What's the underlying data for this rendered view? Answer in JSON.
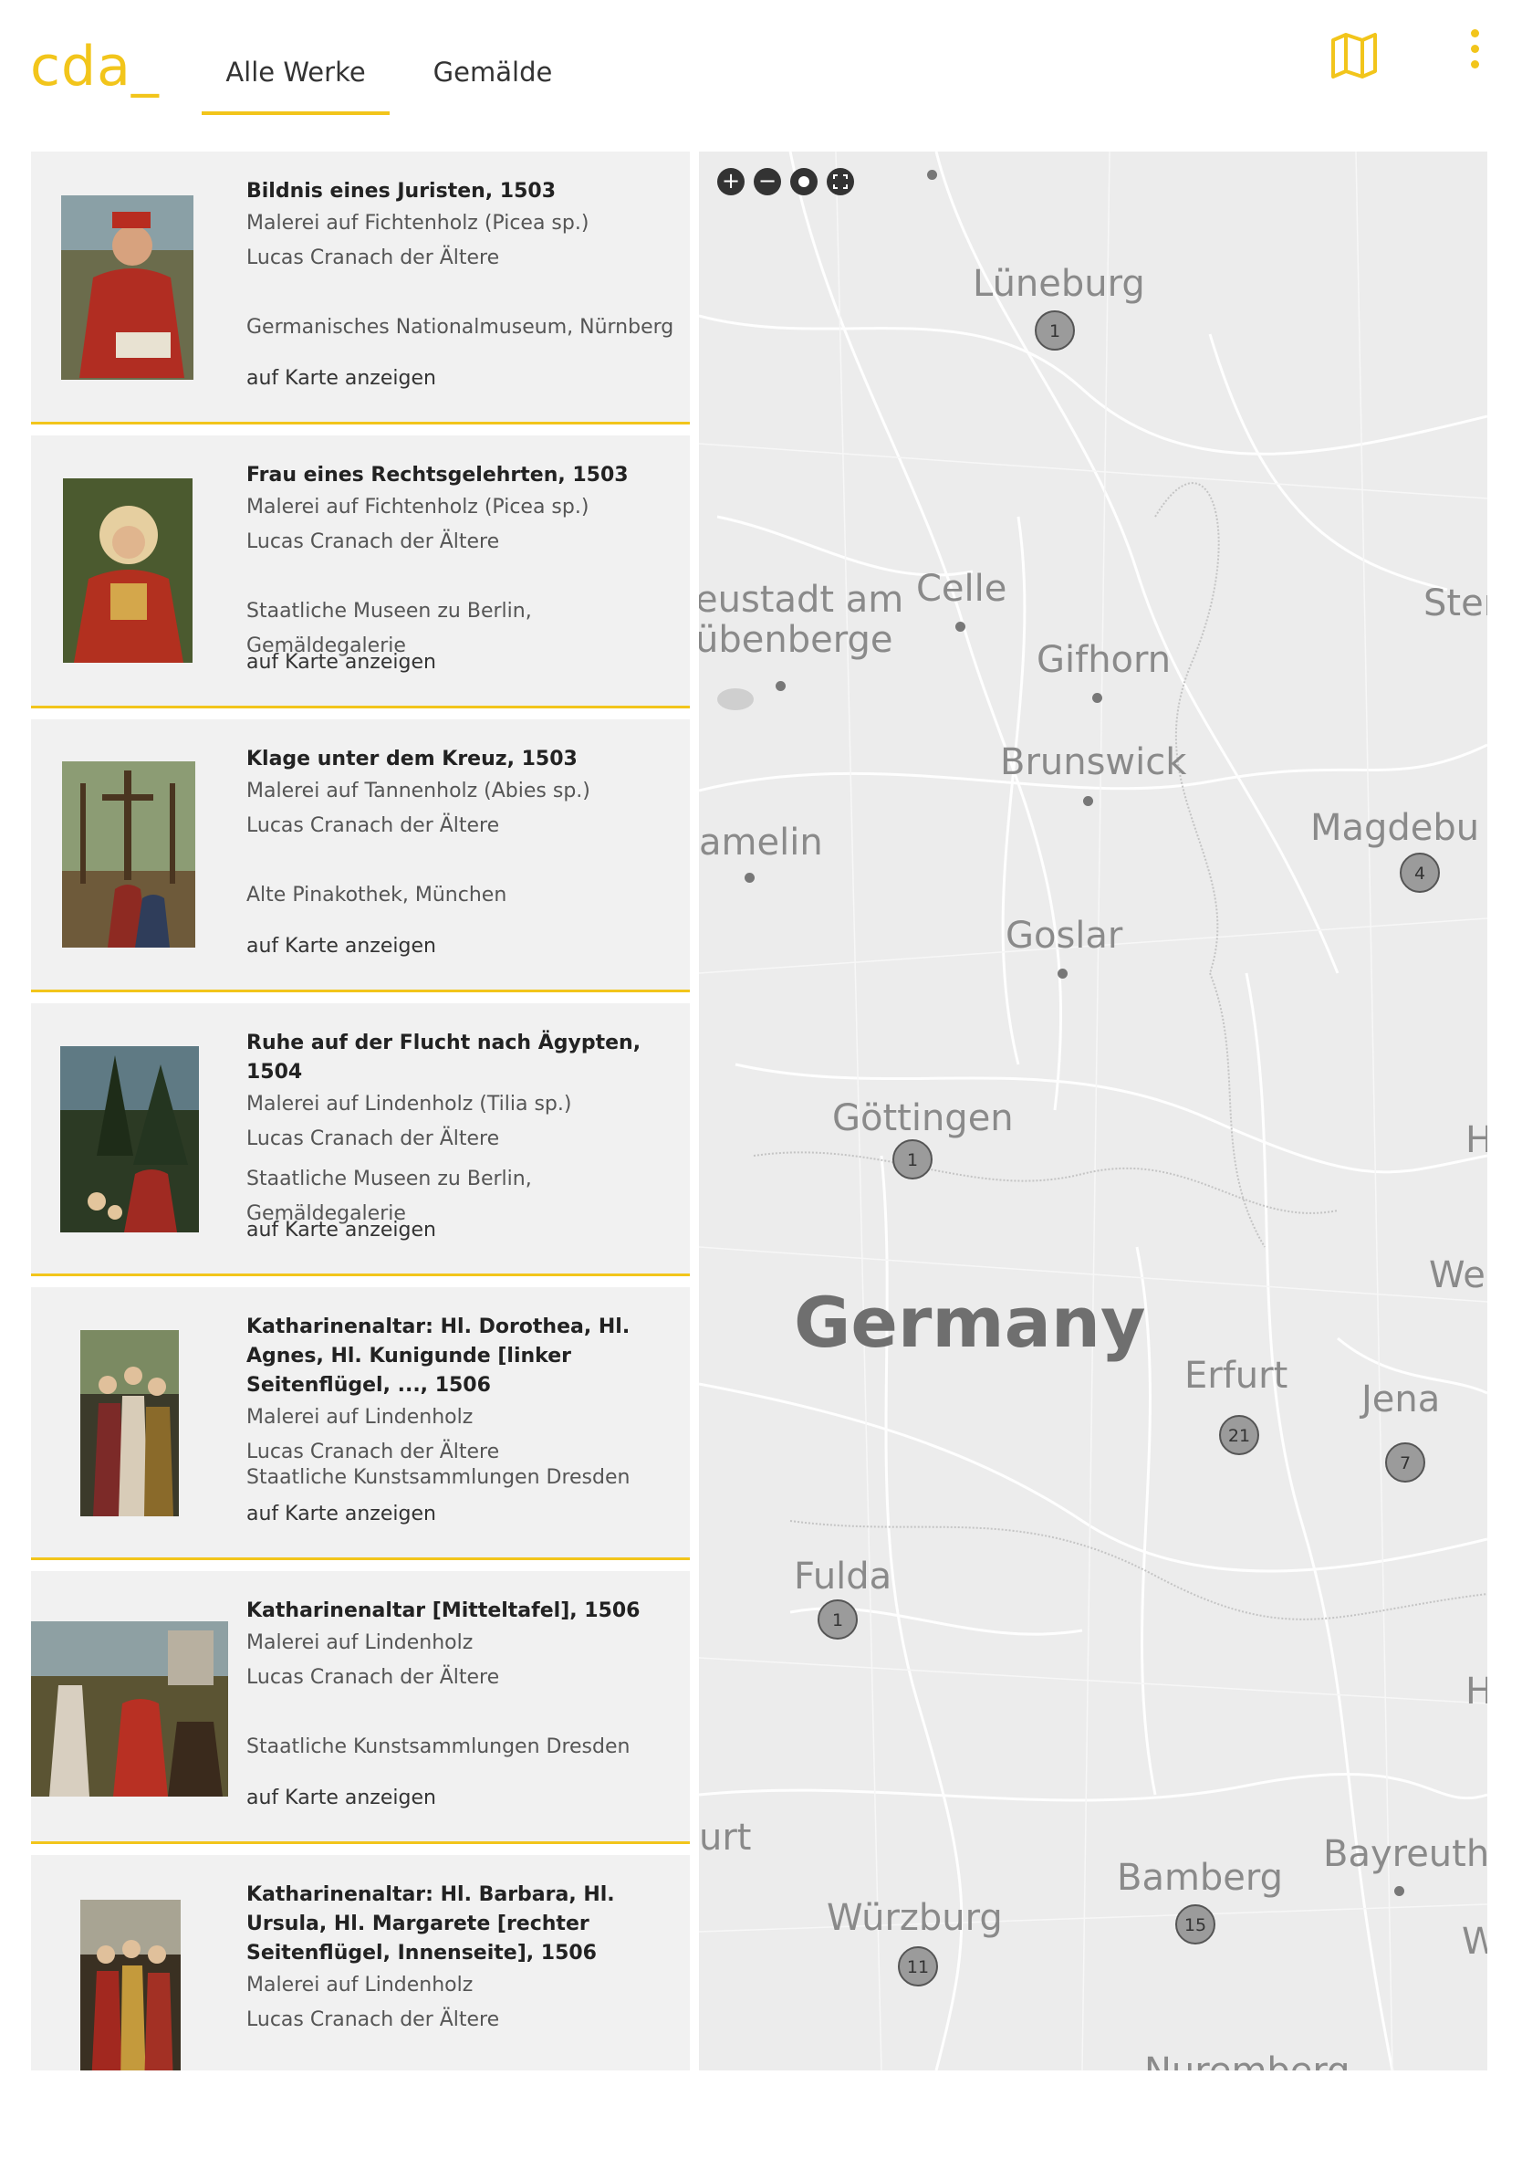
{
  "header": {
    "logo": "cda_",
    "tabs": [
      {
        "label": "Alle Werke",
        "active": true
      },
      {
        "label": "Gemälde",
        "active": false
      }
    ],
    "map_icon": "map-icon",
    "menu_icon": "more-vertical-icon"
  },
  "accent_color": "#f2c51b",
  "works": [
    {
      "title": "Bildnis eines Juristen, 1503",
      "medium": "Malerei auf Fichtenholz (Picea sp.)",
      "artist": "Lucas Cranach der Ältere",
      "museum": "Germanisches Nationalmuseum, Nürnberg",
      "link": "auf Karte anzeigen"
    },
    {
      "title": "Frau eines Rechtsgelehrten, 1503",
      "medium": "Malerei auf Fichtenholz (Picea sp.)",
      "artist": "Lucas Cranach der Ältere",
      "museum": "Staatliche Museen zu Berlin, Gemäldegalerie",
      "link": "auf Karte anzeigen"
    },
    {
      "title": "Klage unter dem Kreuz, 1503",
      "medium": "Malerei auf Tannenholz (Abies sp.)",
      "artist": "Lucas Cranach der Ältere",
      "museum": "Alte Pinakothek, München",
      "link": "auf Karte anzeigen"
    },
    {
      "title": "Ruhe auf der Flucht nach Ägypten, 1504",
      "medium": "Malerei auf Lindenholz (Tilia sp.)",
      "artist": "Lucas Cranach der Ältere",
      "museum": "Staatliche Museen zu Berlin, Gemäldegalerie",
      "link": "auf Karte anzeigen"
    },
    {
      "title": "Katharinenaltar: Hl. Dorothea, Hl. Agnes, Hl. Kunigunde [linker Seitenflügel, ..., 1506",
      "medium": "Malerei auf Lindenholz",
      "artist": "Lucas Cranach der Ältere",
      "museum": "Staatliche Kunstsammlungen Dresden",
      "link": "auf Karte anzeigen"
    },
    {
      "title": "Katharinenaltar [Mitteltafel], 1506",
      "medium": "Malerei auf Lindenholz",
      "artist": "Lucas Cranach der Ältere",
      "museum": "Staatliche Kunstsammlungen Dresden",
      "link": "auf Karte anzeigen"
    },
    {
      "title": "Katharinenaltar: Hl. Barbara, Hl. Ursula, Hl. Margarete [rechter Seitenflügel, Innenseite], 1506",
      "medium": "Malerei auf Lindenholz",
      "artist": "Lucas Cranach der Ältere",
      "museum": "",
      "link": ""
    }
  ],
  "map": {
    "controls": {
      "zoom_in": "+",
      "zoom_out": "−",
      "locate": "locate-icon",
      "fullscreen": "fullscreen-icon"
    },
    "country_label": "Germany",
    "cities": [
      "Lüneburg",
      "Celle",
      "Gifhorn",
      "Brunswick",
      "Magdebu",
      "Goslar",
      "Göttingen",
      "Erfurt",
      "Jena",
      "Fulda",
      "Bamberg",
      "Bayreuth",
      "Würzburg",
      "eustadt am",
      "übenberge",
      "amelin",
      "Ster",
      "Wei",
      "urt",
      "H",
      "H",
      "W",
      "Nuremberg"
    ],
    "markers": [
      "1",
      "4",
      "1",
      "21",
      "7",
      "1",
      "15",
      "11"
    ]
  }
}
